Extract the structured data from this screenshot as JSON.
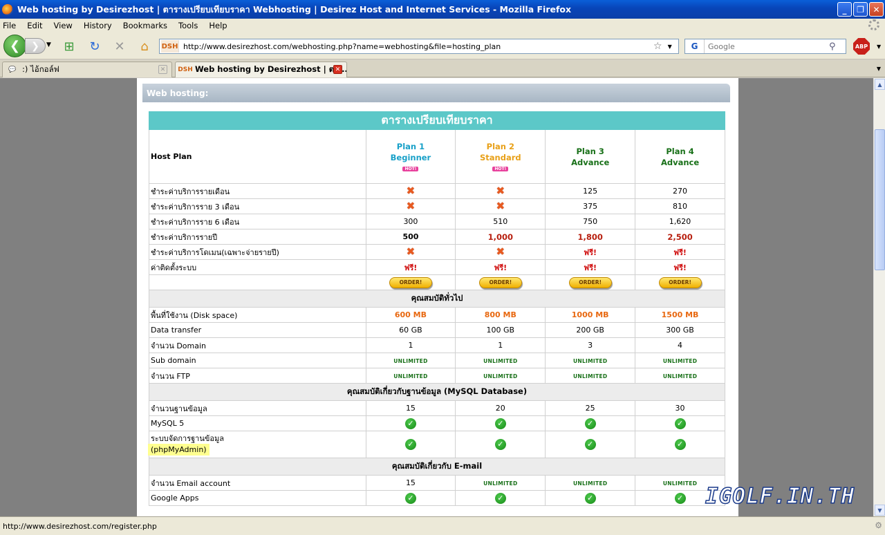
{
  "window": {
    "title": "Web hosting by Desirezhost | ตารางเปรียบเทียบราคา Webhosting | Desirez Host and Internet Services - Mozilla Firefox",
    "minimize": "_",
    "restore": "❐",
    "close": "✕"
  },
  "menu": [
    "File",
    "Edit",
    "View",
    "History",
    "Bookmarks",
    "Tools",
    "Help"
  ],
  "nav": {
    "site_badge": "DSH",
    "url": "http://www.desirezhost.com/webhosting.php?name=webhosting&file=hosting_plan",
    "search_engine": "G",
    "search_placeholder": "Google",
    "abp": "ABP"
  },
  "tabs": [
    {
      "label": ":) ไอ้กอล์ฟ",
      "active": false
    },
    {
      "label": "Web hosting by Desirezhost | ตา...",
      "active": true
    }
  ],
  "page": {
    "section_header": "Web hosting:",
    "table_title": "ตารางเปรียบเทียบราคา",
    "host_plan_label": "Host Plan",
    "hot_badge": "HOT!",
    "plans": [
      {
        "name": "Plan 1",
        "sub": "Beginner",
        "hot": true,
        "color": "#18a0c8"
      },
      {
        "name": "Plan 2",
        "sub": "Standard",
        "hot": true,
        "color": "#e8a018"
      },
      {
        "name": "Plan 3",
        "sub": "Advance",
        "hot": false,
        "color": "#187018"
      },
      {
        "name": "Plan 4",
        "sub": "Advance",
        "hot": false,
        "color": "#187018"
      }
    ],
    "price_rows": [
      {
        "label": "ชำระค่าบริการรายเดือน",
        "cells": [
          "x",
          "x",
          "125",
          "270"
        ]
      },
      {
        "label": "ชำระค่าบริการราย 3 เดือน",
        "cells": [
          "x",
          "x",
          "375",
          "810"
        ]
      },
      {
        "label": "ชำระค่าบริการราย 6 เดือน",
        "cells": [
          "300",
          "510",
          "750",
          "1,620"
        ]
      },
      {
        "label": "ชำระค่าบริการรายปี",
        "cells": [
          "500",
          "1,000",
          "1,800",
          "2,500"
        ]
      },
      {
        "label": "ชำระค่าบริการโดเมน(เฉพาะจ่ายรายปี)",
        "cells": [
          "x",
          "x",
          "ฟรี!",
          "ฟรี!"
        ]
      },
      {
        "label": "ค่าติดตั้งระบบ",
        "cells": [
          "ฟรี!",
          "ฟรี!",
          "ฟรี!",
          "ฟรี!"
        ]
      }
    ],
    "order_label": "ORDER!",
    "general_title": "คุณสมบัติทั่วไป",
    "general_rows": [
      {
        "label": "พื้นที่ใช้งาน (Disk space)",
        "cells": [
          "600 MB",
          "800 MB",
          "1000 MB",
          "1500 MB"
        ]
      },
      {
        "label": "Data transfer",
        "cells": [
          "60 GB",
          "100 GB",
          "200 GB",
          "300 GB"
        ]
      },
      {
        "label": "จำนวน Domain",
        "cells": [
          "1",
          "1",
          "3",
          "4"
        ]
      },
      {
        "label": "Sub domain",
        "cells": [
          "UNLIMITED",
          "UNLIMITED",
          "UNLIMITED",
          "UNLIMITED"
        ]
      },
      {
        "label": "จำนวน FTP",
        "cells": [
          "UNLIMITED",
          "UNLIMITED",
          "UNLIMITED",
          "UNLIMITED"
        ]
      }
    ],
    "db_title": "คุณสมบัติเกี่ยวกับฐานข้อมูล (MySQL Database)",
    "db_rows": [
      {
        "label": "จำนวนฐานข้อมูล",
        "cells": [
          "15",
          "20",
          "25",
          "30"
        ]
      },
      {
        "label": "MySQL 5",
        "cells": [
          "check",
          "check",
          "check",
          "check"
        ]
      }
    ],
    "db_admin_label_1": "ระบบจัดการฐานข้อมูล",
    "db_admin_label_2": "(phpMyAdmin)",
    "email_title": "คุณสมบัติเกี่ยวกับ E-mail",
    "email_rows": [
      {
        "label": "จำนวน Email account",
        "cells": [
          "15",
          "UNLIMITED",
          "UNLIMITED",
          "UNLIMITED"
        ]
      },
      {
        "label": "Google Apps",
        "cells": [
          "check",
          "check",
          "check",
          "check"
        ]
      }
    ]
  },
  "watermark": "IGOLF.IN.TH",
  "status": "http://www.desirezhost.com/register.php"
}
